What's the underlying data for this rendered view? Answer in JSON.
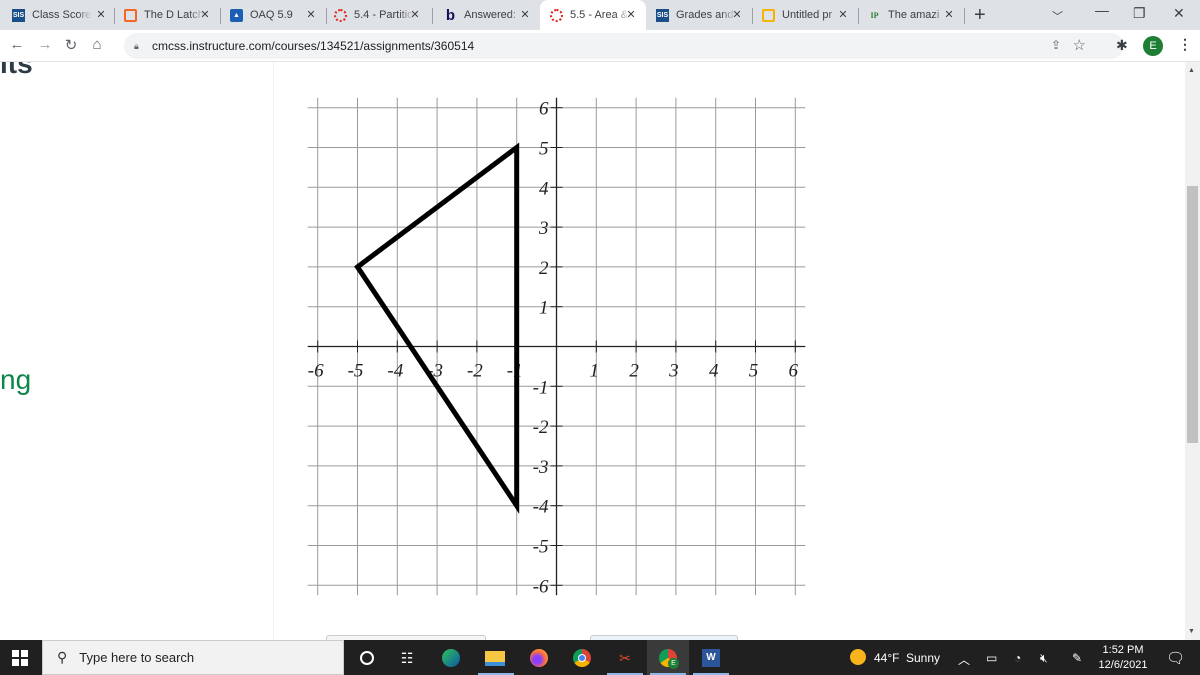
{
  "browser": {
    "tabs": [
      {
        "favicon": "sis-icon",
        "favicon_text": "SIS",
        "title": "Class Score",
        "active": false
      },
      {
        "favicon": "chip-icon",
        "favicon_text": "",
        "title": "The D Latch",
        "active": false
      },
      {
        "favicon": "user-card-icon",
        "favicon_text": "",
        "title": "OAQ 5.9",
        "active": false
      },
      {
        "favicon": "canvas-icon",
        "favicon_text": "",
        "title": "5.4 - Partition",
        "active": false
      },
      {
        "favicon": "bartleby-icon",
        "favicon_text": "b",
        "title": "Answered:",
        "active": false
      },
      {
        "favicon": "canvas-icon",
        "favicon_text": "",
        "title": "5.5 - Area &",
        "active": true
      },
      {
        "favicon": "sis-icon",
        "favicon_text": "SIS",
        "title": "Grades and",
        "active": false
      },
      {
        "favicon": "slides-icon",
        "favicon_text": "",
        "title": "Untitled pr",
        "active": false
      },
      {
        "favicon": "ip-icon",
        "favicon_text": "IP",
        "title": "The amazi",
        "active": false
      }
    ],
    "close_glyph": "✕",
    "new_tab_glyph": "+",
    "url": "cmcss.instructure.com/courses/134521/assignments/360514",
    "profile_initial": "E"
  },
  "page": {
    "heading_fragment": "its",
    "green_fragment": "ng",
    "accent_green": "#0b874b",
    "heading_color": "#2d3b45"
  },
  "chart_data": {
    "type": "line",
    "title": "",
    "xlabel": "",
    "ylabel": "",
    "xlim": [
      -6,
      6
    ],
    "ylim": [
      -6,
      6
    ],
    "grid": true,
    "x_ticks": [
      -6,
      -5,
      -4,
      -3,
      -2,
      -1,
      1,
      2,
      3,
      4,
      5,
      6
    ],
    "y_ticks": [
      6,
      5,
      4,
      3,
      2,
      1,
      -1,
      -2,
      -3,
      -4,
      -5,
      -6
    ],
    "series": [
      {
        "name": "triangle",
        "closed": true,
        "points": [
          [
            -1,
            5
          ],
          [
            -5,
            2
          ],
          [
            -1,
            -4
          ]
        ]
      }
    ]
  },
  "taskbar": {
    "search_placeholder": "Type here to search",
    "weather_temp": "44°F",
    "weather_desc": "Sunny",
    "time": "1:52 PM",
    "date": "12/6/2021",
    "pinned": [
      "cortana-icon",
      "task-view-icon",
      "edge-icon",
      "file-explorer-icon",
      "firefox-icon",
      "chrome-icon",
      "snipping-tool-icon",
      "chrome-profile-icon",
      "word-icon"
    ]
  }
}
